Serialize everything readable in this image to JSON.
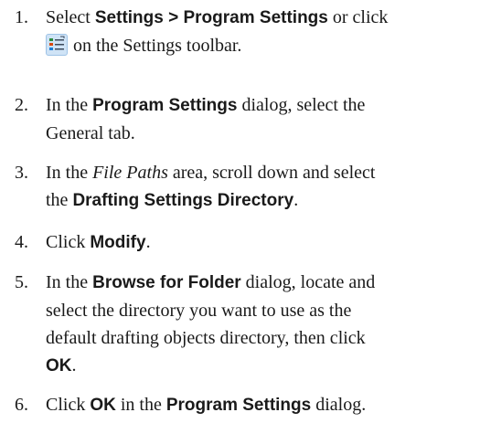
{
  "steps": [
    {
      "num": "1.",
      "parts": [
        "Select ",
        "Settings > Program Settings",
        " or click",
        "on the Settings toolbar."
      ]
    },
    {
      "num": "2.",
      "parts": [
        "In the ",
        "Program Settings",
        " dialog, select the",
        "General tab."
      ]
    },
    {
      "num": "3.",
      "parts": [
        "In the ",
        "File Paths",
        " area, scroll down and select",
        "the ",
        "Drafting Settings Directory",
        "."
      ]
    },
    {
      "num": "4.",
      "parts": [
        "Click ",
        "Modify",
        "."
      ]
    },
    {
      "num": "5.",
      "parts": [
        "In the ",
        "Browse for Folder",
        " dialog, locate and",
        "select the directory you want to use as the",
        "default drafting objects directory, then click",
        "OK",
        "."
      ]
    },
    {
      "num": "6.",
      "parts": [
        "Click ",
        "OK",
        " in the ",
        "Program Settings",
        " dialog."
      ]
    }
  ],
  "icons": {
    "toolbar_icon": "program-settings-icon"
  }
}
